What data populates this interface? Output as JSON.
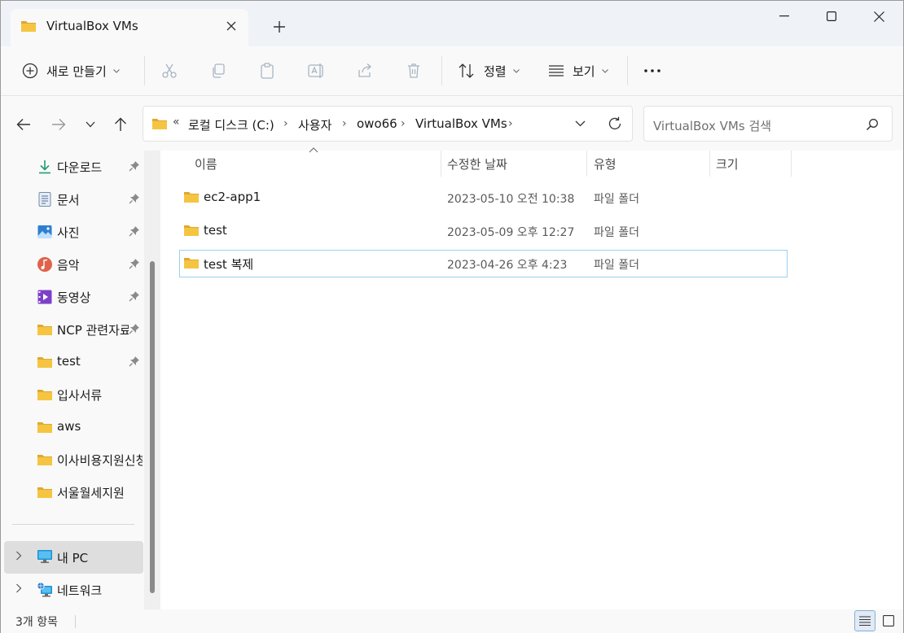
{
  "window": {
    "tab_title": "VirtualBox VMs",
    "new_tab": "+"
  },
  "commands": {
    "new_label": "새로 만들기",
    "sort_label": "정렬",
    "view_label": "보기",
    "more": "•••"
  },
  "address": {
    "overflow": "«",
    "crumbs": [
      "로컬 디스크 (C:)",
      "사용자",
      "owo66",
      "VirtualBox VMs"
    ],
    "search_placeholder": "VirtualBox VMs 검색"
  },
  "sidebar": {
    "quick_access": [
      {
        "label": "다운로드",
        "icon": "download-icon",
        "pinned": true
      },
      {
        "label": "문서",
        "icon": "document-icon",
        "pinned": true
      },
      {
        "label": "사진",
        "icon": "pictures-icon",
        "pinned": true
      },
      {
        "label": "음악",
        "icon": "music-icon",
        "pinned": true
      },
      {
        "label": "동영상",
        "icon": "video-icon",
        "pinned": true
      },
      {
        "label": "NCP 관련자료",
        "icon": "folder-icon",
        "pinned": true
      },
      {
        "label": "test",
        "icon": "folder-icon",
        "pinned": true
      },
      {
        "label": "입사서류",
        "icon": "folder-icon",
        "pinned": false
      },
      {
        "label": "aws",
        "icon": "folder-icon",
        "pinned": false
      },
      {
        "label": "이사비용지원신청",
        "icon": "folder-icon",
        "pinned": false
      },
      {
        "label": "서울월세지원",
        "icon": "folder-icon",
        "pinned": false
      }
    ],
    "this_pc": "내 PC",
    "network": "네트워크"
  },
  "columns": {
    "name": "이름",
    "date": "수정한 날짜",
    "type": "유형",
    "size": "크기"
  },
  "files": [
    {
      "name": "ec2-app1",
      "date": "2023-05-10 오전 10:38",
      "type": "파일 폴더"
    },
    {
      "name": "test",
      "date": "2023-05-09 오후 12:27",
      "type": "파일 폴더"
    },
    {
      "name": "test 복제",
      "date": "2023-04-26 오후 4:23",
      "type": "파일 폴더"
    }
  ],
  "status": {
    "item_count": "3개 항목"
  },
  "colors": {
    "folder": "#f5c542",
    "folder_dark": "#e0a82e",
    "accent": "#0067c0",
    "selection_border": "#99d1ef"
  }
}
